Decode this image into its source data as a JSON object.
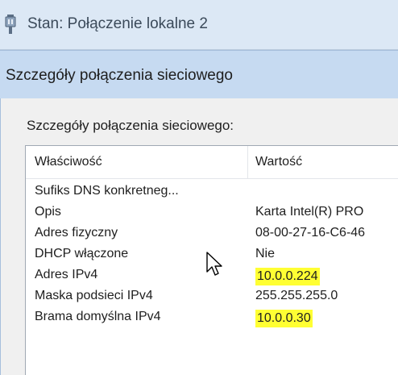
{
  "parent_window": {
    "title": "Stan: Połączenie lokalne 2",
    "icon": "network-connection-icon"
  },
  "dialog": {
    "title": "Szczegóły połączenia sieciowego",
    "section_label": "Szczegóły połączenia sieciowego:",
    "columns": [
      "Właściwość",
      "Wartość"
    ],
    "rows": [
      {
        "property": "Sufiks DNS konkretneg...",
        "value": ""
      },
      {
        "property": "Opis",
        "value": "Karta Intel(R) PRO"
      },
      {
        "property": "Adres fizyczny",
        "value": "08-00-27-16-C6-46"
      },
      {
        "property": "DHCP włączone",
        "value": "Nie"
      },
      {
        "property": "Adres IPv4",
        "value": "10.0.0.224"
      },
      {
        "property": "Maska podsieci IPv4",
        "value": "255.255.255.0"
      },
      {
        "property": "Brama domyślna IPv4",
        "value": "10.0.0.30"
      }
    ],
    "highlight_color": "#ffff33"
  },
  "cursor": {
    "icon": "mouse-pointer-icon"
  }
}
